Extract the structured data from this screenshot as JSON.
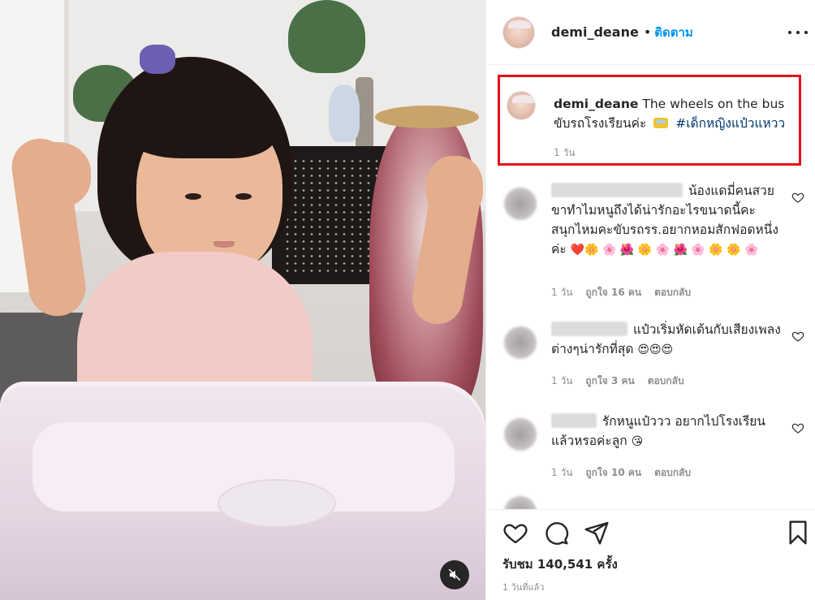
{
  "post": {
    "username": "demi_deane",
    "follow_label": "ติดตาม",
    "separator": "•",
    "caption": {
      "username": "demi_deane",
      "text_before": "The wheels on the bus ขับรถโรงเรียนค่ะ",
      "hashtag": "#เด็กหญิงแป๋วแหวว",
      "time": "1 วัน"
    },
    "views": "รับชม 140,541 ครั้ง",
    "posted_ago": "1 วันที่แล้ว"
  },
  "comments": [
    {
      "text": "น้องแดมี่คนสวยขาทำไมหนูถึงได้น่ารักอะไรขนาดนี้คะ สนุกไหมคะขับรถรร.อยากหอมสักฟอดหนึ่งค่ะ",
      "time": "1 วัน",
      "likes": "ถูกใจ 16 คน",
      "reply": "ตอบกลับ"
    },
    {
      "text": "แป๋วเริ่มหัดเต้นกับเสียงเพลงต่างๆน่ารักที่สุด",
      "time": "1 วัน",
      "likes": "ถูกใจ 3 คน",
      "reply": "ตอบกลับ"
    },
    {
      "text": "รักหนูแป๋ววว อยากไปโรงเรียนแล้วหรอค่ะลูก",
      "time": "1 วัน",
      "likes": "ถูกใจ 10 คน",
      "reply": "ตอบกลับ"
    }
  ],
  "icons": {
    "like": "heart-icon",
    "comment": "comment-icon",
    "share": "share-icon",
    "save": "bookmark-icon",
    "more": "more-options-icon",
    "mute": "muted-speaker-icon"
  },
  "colors": {
    "link": "#0095f6",
    "hashtag": "#00376b",
    "highlight_box": "#e3101a",
    "muted_text": "#8e8e8e"
  }
}
